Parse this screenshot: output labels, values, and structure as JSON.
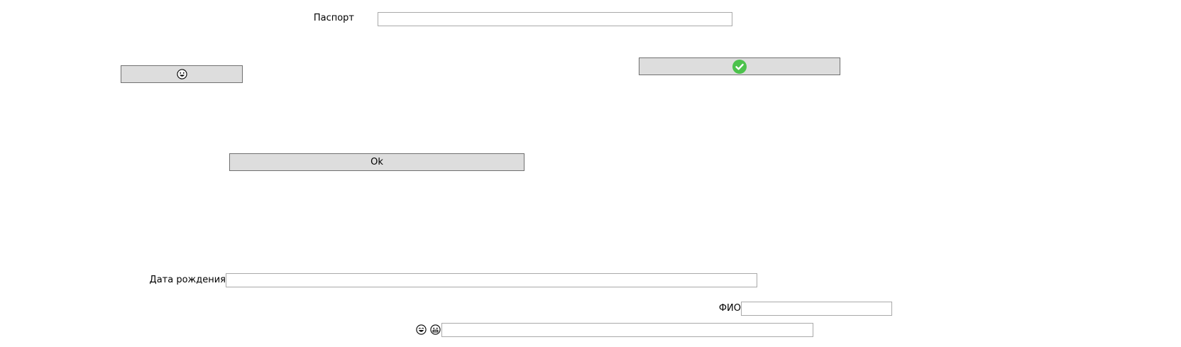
{
  "form": {
    "passport_label": "Паспорт",
    "passport_value": "",
    "birthdate_label": "Дата рождения",
    "birthdate_value": "",
    "fio_label": "ФИО",
    "fio_value": "",
    "emoji_field_value": "",
    "ok_button_label": "Ok"
  },
  "icons": {
    "confirm_button_icon": "check-circle-icon",
    "smiley_button_icon": "grinning-face-icon",
    "emoji_field_icons": [
      "laughing-face-icon",
      "grinning-face-icon"
    ]
  },
  "colors": {
    "button_bg": "#dddddd",
    "button_border": "#707070",
    "field_border": "#a9a9a9",
    "check_green": "#4cc24c"
  }
}
